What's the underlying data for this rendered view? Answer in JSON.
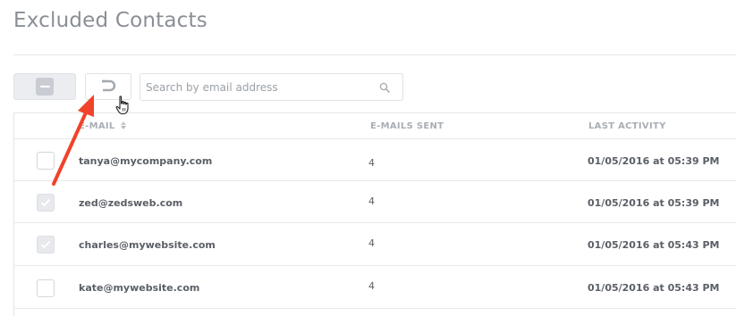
{
  "page": {
    "title": "Excluded Contacts"
  },
  "toolbar": {
    "bulk_action_icon": "minus-square-icon",
    "undo_icon": "undo-icon",
    "search_placeholder": "Search by email address",
    "search_value": "",
    "search_icon": "search-icon"
  },
  "table": {
    "headers": {
      "email": "E-MAIL",
      "sent": "E-MAILS SENT",
      "activity": "LAST ACTIVITY"
    },
    "sorted_column": "email",
    "rows": [
      {
        "email": "tanya@mycompany.com",
        "sent": "4",
        "activity": "01/05/2016 at 05:39 PM",
        "checked": false
      },
      {
        "email": "zed@zedsweb.com",
        "sent": "4",
        "activity": "01/05/2016 at 05:39 PM",
        "checked": true
      },
      {
        "email": "charles@mywebsite.com",
        "sent": "4",
        "activity": "01/05/2016 at 05:43 PM",
        "checked": true
      },
      {
        "email": "kate@mywebsite.com",
        "sent": "4",
        "activity": "01/05/2016 at 05:43 PM",
        "checked": false
      }
    ]
  },
  "annotation": {
    "arrow_color": "#f0432a",
    "cursor": "hand-pointer-icon"
  }
}
